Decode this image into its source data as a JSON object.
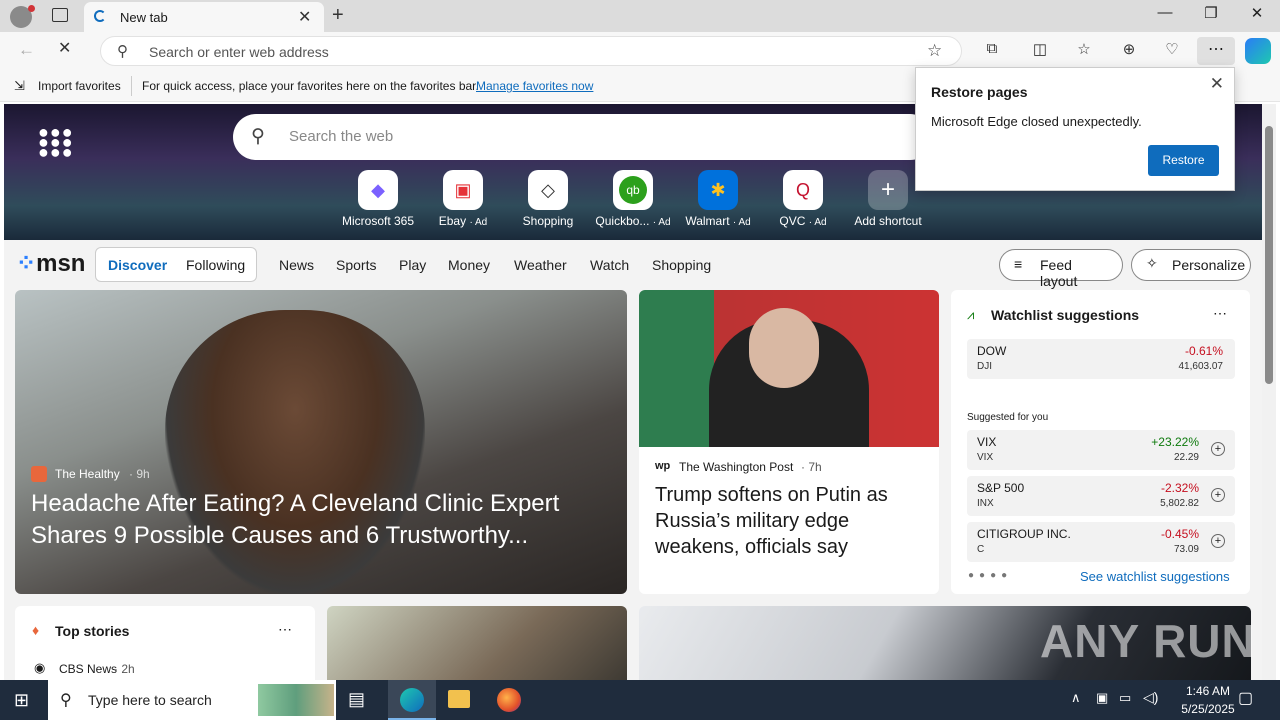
{
  "browser": {
    "tab_title": "New tab",
    "address_placeholder": "Search or enter web address"
  },
  "favbar": {
    "import": "Import favorites",
    "message": "For quick access, place your favorites here on the favorites bar.",
    "manage_link": "Manage favorites now"
  },
  "ntp": {
    "search_placeholder": "Search the web",
    "shortcuts": [
      {
        "label": "Microsoft 365",
        "ad": ""
      },
      {
        "label": "Ebay",
        "ad": "· Ad"
      },
      {
        "label": "Shopping",
        "ad": ""
      },
      {
        "label": "Quickbo...",
        "ad": "· Ad"
      },
      {
        "label": "Walmart",
        "ad": "· Ad"
      },
      {
        "label": "QVC",
        "ad": "· Ad"
      },
      {
        "label": "Add shortcut",
        "ad": ""
      }
    ]
  },
  "msn": {
    "logo": "msn",
    "tabs": [
      "Discover",
      "Following"
    ],
    "nav": [
      "News",
      "Sports",
      "Play",
      "Money",
      "Weather",
      "Watch",
      "Shopping"
    ],
    "feed_layout": "Feed layout",
    "personalize": "Personalize"
  },
  "lead_story": {
    "source": "The Healthy",
    "age": "· 9h",
    "headline": "Headache After Eating? A Cleveland Clinic Expert Shares 9 Possible Causes and 6 Trustworthy..."
  },
  "story2": {
    "source": "The Washington Post",
    "age": "· 7h",
    "headline": "Trump softens on Putin as Russia’s military edge weakens, officials say"
  },
  "watchlist": {
    "title": "Watchlist suggestions",
    "suggested_label": "Suggested for you",
    "see_all": "See watchlist suggestions",
    "index": {
      "name": "DOW",
      "symbol": "DJI",
      "change": "-0.61%",
      "value": "41,603.07"
    },
    "items": [
      {
        "name": "VIX",
        "symbol": "VIX",
        "change": "+23.22%",
        "value": "22.29"
      },
      {
        "name": "S&P 500",
        "symbol": "INX",
        "change": "-2.32%",
        "value": "5,802.82"
      },
      {
        "name": "CITIGROUP INC.",
        "symbol": "C",
        "change": "-0.45%",
        "value": "73.09"
      }
    ]
  },
  "top_stories": {
    "title": "Top stories",
    "first_source": "CBS News",
    "first_age": "· 2h"
  },
  "popup": {
    "title": "Restore pages",
    "message": "Microsoft Edge closed unexpectedly.",
    "button": "Restore"
  },
  "watermark": "ANY RUN",
  "taskbar": {
    "search_placeholder": "Type here to search",
    "time": "1:46 AM",
    "date": "5/25/2025"
  },
  "colors": {
    "accent": "#0f6cbd",
    "negative": "#c50f1f",
    "positive": "#0e7a0d"
  }
}
